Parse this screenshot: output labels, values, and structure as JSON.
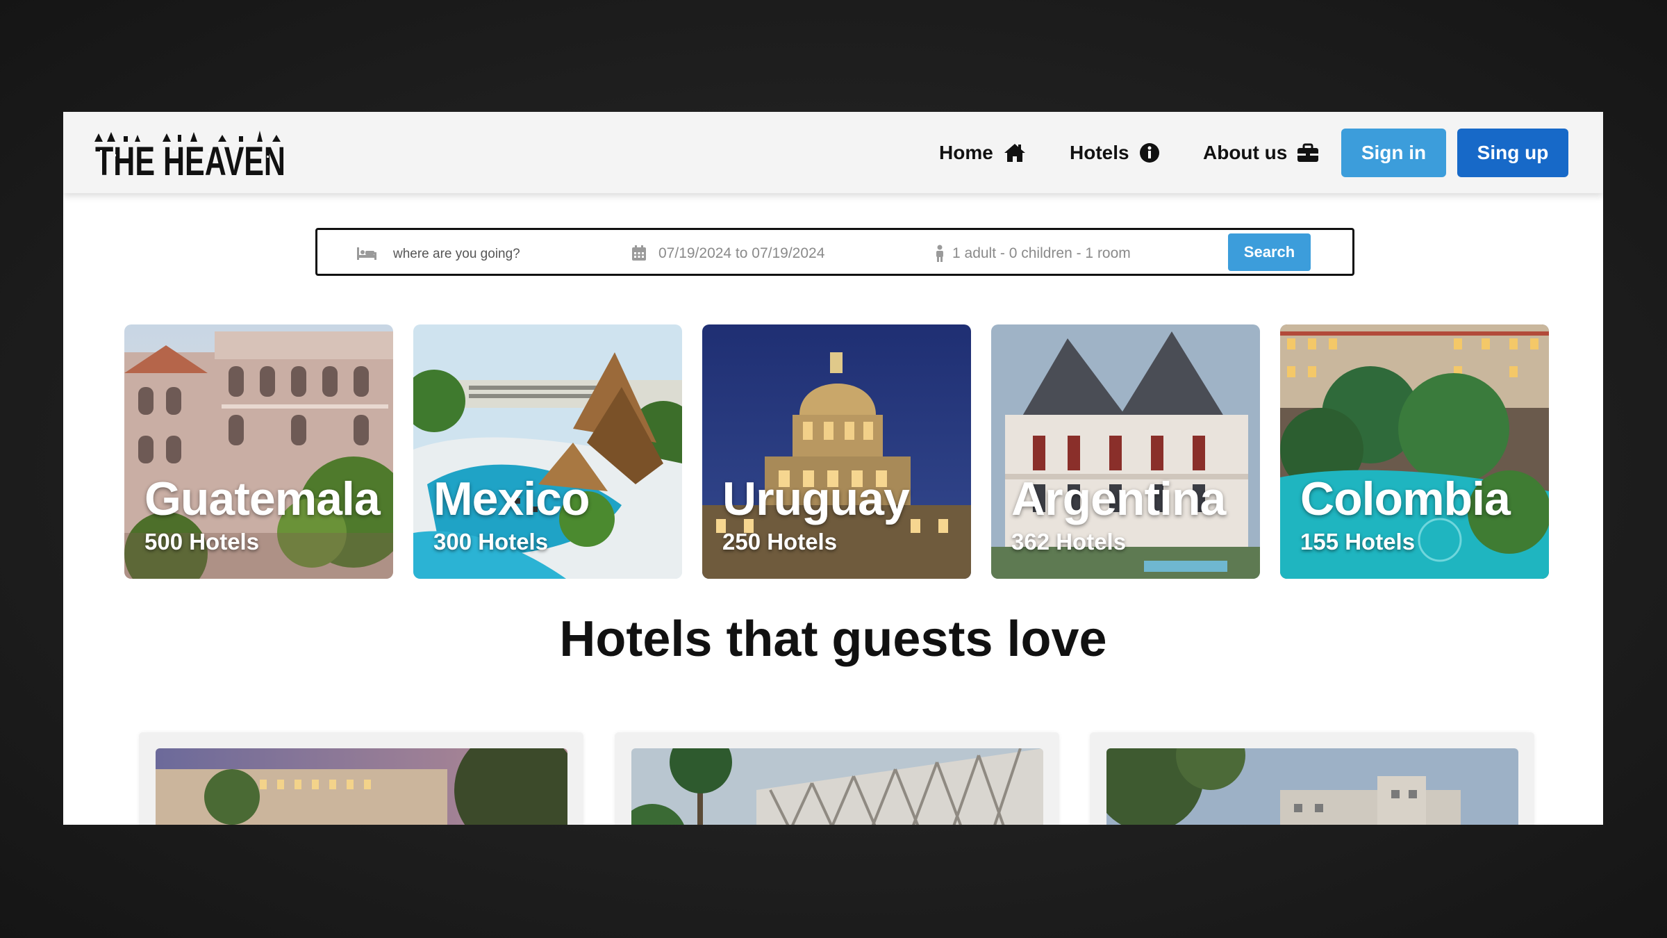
{
  "brand": {
    "logo_text": "THE HEAVEN"
  },
  "nav": {
    "home": "Home",
    "hotels": "Hotels",
    "about": "About us",
    "sign_in": "Sign in",
    "sign_up": "Sing up"
  },
  "search": {
    "destination_placeholder": "where are you going?",
    "dates": "07/19/2024 to 07/19/2024",
    "guests": "1 adult - 0 children - 1 room",
    "button": "Search",
    "icons": [
      "bed-icon",
      "calendar-icon",
      "person-icon"
    ]
  },
  "destinations": [
    {
      "name": "Guatemala",
      "count": "500 Hotels"
    },
    {
      "name": "Mexico",
      "count": "300 Hotels"
    },
    {
      "name": "Uruguay",
      "count": "250 Hotels"
    },
    {
      "name": "Argentina",
      "count": "362 Hotels"
    },
    {
      "name": "Colombia",
      "count": "155 Hotels"
    }
  ],
  "section": {
    "title": "Hotels that guests love"
  },
  "colors": {
    "accent_light": "#3c9ddb",
    "accent_dark": "#1769c8",
    "navbar_bg": "#f4f4f4",
    "backdrop": "#1f1f1f"
  }
}
